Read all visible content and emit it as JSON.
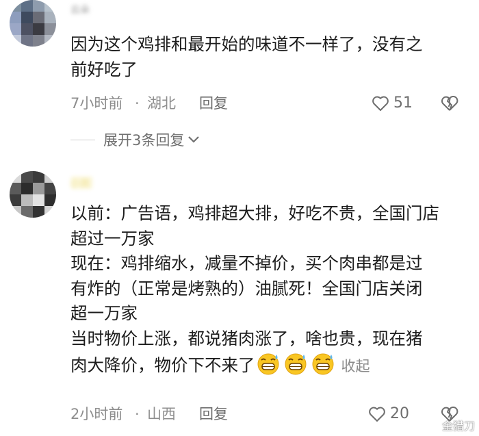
{
  "comments": [
    {
      "username": "云朵",
      "lines": [
        "因为这个鸡排和最开始的味道不一样了，没有之",
        "前好吃了"
      ],
      "time": "7小时前",
      "dot": "·",
      "location": "湖北",
      "reply_label": "回复",
      "likes": "51",
      "expand_label": "展开3条回复"
    },
    {
      "username": "小黄",
      "lines": [
        "以前：广告语，鸡排超大排，好吃不贵，全国门店",
        "超过一万家",
        "现在：鸡排缩水，减量不掉价，买个肉串都是过",
        "有炸的（正常是烤熟的）油腻死！全国门店关闭",
        "超一万家",
        "当时物价上涨，都说猪肉涨了，啥也贵，现在猪"
      ],
      "last_line": "肉大降价，物价下不来了",
      "collapse_label": "收起",
      "time": "2小时前",
      "dot": "·",
      "location": "山西",
      "reply_label": "回复",
      "likes": "20"
    }
  ],
  "watermark": "金猎刀",
  "icons": [
    "heart-outline-icon",
    "broken-heart-icon",
    "chevron-down-icon",
    "grinning-sweat-emoji",
    "weibo-logo-icon"
  ]
}
